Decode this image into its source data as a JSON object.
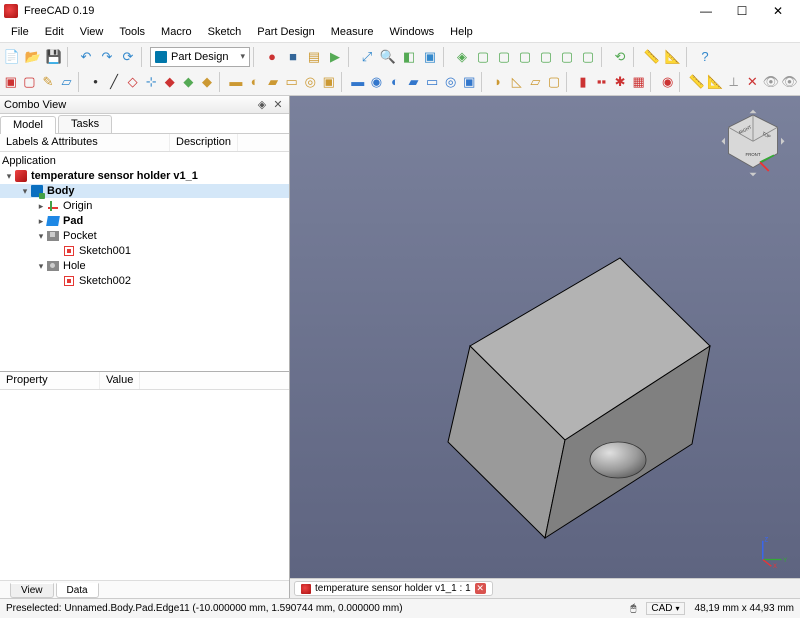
{
  "titlebar": {
    "title": "FreeCAD 0.19"
  },
  "menubar": [
    "File",
    "Edit",
    "View",
    "Tools",
    "Macro",
    "Sketch",
    "Part Design",
    "Measure",
    "Windows",
    "Help"
  ],
  "workbench_selector": {
    "label": "Part Design"
  },
  "combo": {
    "title": "Combo View",
    "tabs": {
      "model": "Model",
      "tasks": "Tasks"
    },
    "headers": {
      "labels": "Labels & Attributes",
      "description": "Description"
    },
    "tree_root": "Application",
    "tree": [
      {
        "indent": 0,
        "arrow": "▾",
        "icon": "doc",
        "label": "temperature sensor holder v1_1",
        "bold": true
      },
      {
        "indent": 1,
        "arrow": "▾",
        "icon": "body",
        "label": "Body",
        "bold": true,
        "selected": true
      },
      {
        "indent": 2,
        "arrow": "▸",
        "icon": "origin",
        "label": "Origin"
      },
      {
        "indent": 2,
        "arrow": "▸",
        "icon": "pad",
        "label": "Pad",
        "bold": true
      },
      {
        "indent": 2,
        "arrow": "▾",
        "icon": "pocket",
        "label": "Pocket"
      },
      {
        "indent": 3,
        "arrow": "",
        "icon": "sketch",
        "label": "Sketch001"
      },
      {
        "indent": 2,
        "arrow": "▾",
        "icon": "hole",
        "label": "Hole"
      },
      {
        "indent": 3,
        "arrow": "",
        "icon": "sketch",
        "label": "Sketch002"
      }
    ],
    "prop_headers": {
      "property": "Property",
      "value": "Value"
    },
    "bottom_tabs": {
      "view": "View",
      "data": "Data"
    }
  },
  "doc_tab": {
    "name": "temperature sensor holder v1_1 : 1"
  },
  "statusbar": {
    "preselect": "Preselected: Unnamed.Body.Pad.Edge11 (-10.000000 mm, 1.590744 mm, 0.000000 mm)",
    "navstyle": "CAD",
    "dims": "48,19 mm x 44,93 mm"
  },
  "toolbar_row1": [
    {
      "name": "new-doc",
      "c": "#4a5",
      "g": "📄"
    },
    {
      "name": "open",
      "c": "#cc9933",
      "g": "📂"
    },
    {
      "name": "save",
      "c": "#3377cc",
      "g": "💾"
    },
    {
      "sep": true
    },
    {
      "name": "undo",
      "c": "#3388cc",
      "g": "↶"
    },
    {
      "name": "redo",
      "c": "#3388cc",
      "g": "↷"
    },
    {
      "name": "refresh",
      "c": "#3388cc",
      "g": "⟳"
    },
    {
      "sep": true
    },
    {
      "name": "workbench-selector"
    },
    {
      "sep": true
    },
    {
      "name": "record-macro",
      "c": "#cc3333",
      "g": "●"
    },
    {
      "name": "stop-macro",
      "c": "#336699",
      "g": "■"
    },
    {
      "name": "macro",
      "c": "#cc9933",
      "g": "▤"
    },
    {
      "name": "run-macro",
      "c": "#55aa55",
      "g": "▶"
    },
    {
      "sep": true
    },
    {
      "name": "fit-all",
      "c": "#3388cc",
      "g": "⤢"
    },
    {
      "name": "fit-selection",
      "c": "#3388cc",
      "g": "🔍"
    },
    {
      "name": "draw-style",
      "c": "#55aa55",
      "g": "◧"
    },
    {
      "name": "bounding-box",
      "c": "#3388cc",
      "g": "▣"
    },
    {
      "sep": true
    },
    {
      "name": "isometric",
      "c": "#55aa55",
      "g": "◈"
    },
    {
      "name": "front",
      "c": "#55aa55",
      "g": "▢"
    },
    {
      "name": "top",
      "c": "#55aa55",
      "g": "▢"
    },
    {
      "name": "right",
      "c": "#55aa55",
      "g": "▢"
    },
    {
      "name": "rear",
      "c": "#55aa55",
      "g": "▢"
    },
    {
      "name": "bottom",
      "c": "#55aa55",
      "g": "▢"
    },
    {
      "name": "left",
      "c": "#55aa55",
      "g": "▢"
    },
    {
      "sep": true
    },
    {
      "name": "rotate",
      "c": "#55aa55",
      "g": "⟲"
    },
    {
      "sep": true
    },
    {
      "name": "measure-linear",
      "c": "#cc9933",
      "g": "📏"
    },
    {
      "name": "measure-angular",
      "c": "#cc9933",
      "g": "📐"
    },
    {
      "sep": true
    },
    {
      "name": "whats-this",
      "c": "#3388cc",
      "g": "?"
    }
  ],
  "toolbar_row2": [
    {
      "name": "create-body",
      "c": "#cc3333",
      "g": "▣"
    },
    {
      "name": "create-sketch",
      "c": "#cc3333",
      "g": "▢"
    },
    {
      "name": "edit-sketch",
      "c": "#cc9933",
      "g": "✎"
    },
    {
      "name": "map-sketch",
      "c": "#3388cc",
      "g": "▱"
    },
    {
      "sep": true
    },
    {
      "name": "point",
      "c": "#333",
      "g": "•"
    },
    {
      "name": "line",
      "c": "#333",
      "g": "╱"
    },
    {
      "name": "plane",
      "c": "#cc3333",
      "g": "◇"
    },
    {
      "name": "lcs",
      "c": "#3388cc",
      "g": "⊹"
    },
    {
      "name": "shapebinder",
      "c": "#cc3333",
      "g": "◆"
    },
    {
      "name": "subshape",
      "c": "#55aa55",
      "g": "◆"
    },
    {
      "name": "clone",
      "c": "#cc9933",
      "g": "◆"
    },
    {
      "sep": true
    },
    {
      "name": "pad",
      "c": "#cc9933",
      "g": "▬"
    },
    {
      "name": "revolution",
      "c": "#cc9933",
      "g": "◐"
    },
    {
      "name": "loft",
      "c": "#cc9933",
      "g": "▰"
    },
    {
      "name": "pipe",
      "c": "#cc9933",
      "g": "▭"
    },
    {
      "name": "additive-helix",
      "c": "#cc9933",
      "g": "◎"
    },
    {
      "name": "additive-box",
      "c": "#cc9933",
      "g": "▣"
    },
    {
      "sep": true
    },
    {
      "name": "pocket",
      "c": "#3377cc",
      "g": "▬"
    },
    {
      "name": "hole",
      "c": "#3377cc",
      "g": "◉"
    },
    {
      "name": "groove",
      "c": "#3377cc",
      "g": "◐"
    },
    {
      "name": "sub-loft",
      "c": "#3377cc",
      "g": "▰"
    },
    {
      "name": "sub-pipe",
      "c": "#3377cc",
      "g": "▭"
    },
    {
      "name": "sub-helix",
      "c": "#3377cc",
      "g": "◎"
    },
    {
      "name": "sub-box",
      "c": "#3377cc",
      "g": "▣"
    },
    {
      "sep": true
    },
    {
      "name": "fillet",
      "c": "#cc9933",
      "g": "◗"
    },
    {
      "name": "chamfer",
      "c": "#cc9933",
      "g": "◺"
    },
    {
      "name": "draft",
      "c": "#cc9933",
      "g": "▱"
    },
    {
      "name": "thickness",
      "c": "#cc9933",
      "g": "▢"
    },
    {
      "sep": true
    },
    {
      "name": "mirror",
      "c": "#cc3333",
      "g": "▮"
    },
    {
      "name": "linear-pattern",
      "c": "#cc3333",
      "g": "▪▪"
    },
    {
      "name": "polar-pattern",
      "c": "#cc3333",
      "g": "✱"
    },
    {
      "name": "multi-transform",
      "c": "#cc3333",
      "g": "▦"
    },
    {
      "sep": true
    },
    {
      "name": "boolean",
      "c": "#cc3333",
      "g": "◉"
    },
    {
      "sep": true
    },
    {
      "name": "measure1",
      "c": "#999",
      "g": "📏"
    },
    {
      "name": "measure2",
      "c": "#999",
      "g": "📐"
    },
    {
      "name": "measure3",
      "c": "#999",
      "g": "⟂"
    },
    {
      "name": "clear-measure",
      "c": "#cc3333",
      "g": "✕"
    },
    {
      "name": "toggle-measure",
      "c": "#999",
      "g": "👁"
    },
    {
      "name": "toggle-measure2",
      "c": "#999",
      "g": "👁"
    }
  ]
}
